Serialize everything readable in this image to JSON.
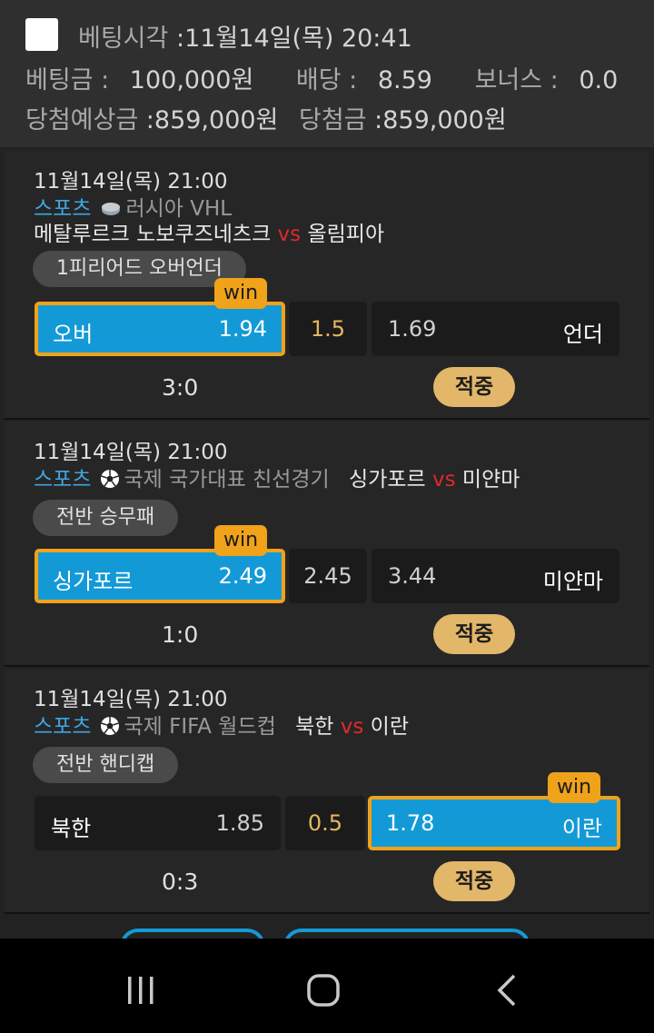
{
  "header": {
    "bet_time_label": "베팅시각",
    "bet_time_value": ":11월14일(목) 20:41",
    "amount_label": "베팅금 :",
    "amount_value": "100,000원",
    "odds_label": "배당 :",
    "odds_value": "8.59",
    "bonus_label": "보너스 :",
    "bonus_value": "0.0",
    "expected_label": "당첨예상금",
    "expected_value": ":859,000원",
    "won_label": "당첨금",
    "won_value": ":859,000원"
  },
  "bets": [
    {
      "time": "11월14일(목) 21:00",
      "category": "스포츠",
      "icon": "hockey-puck-icon",
      "league": "러시아 VHL",
      "home": "메탈루르크 노보쿠즈네츠크",
      "vs": "vs",
      "away": "올림피아",
      "market": "1피리어드 오버언더",
      "left_name": "오버",
      "left_odds": "1.94",
      "middle": "1.5",
      "right_odds": "1.69",
      "right_name": "언더",
      "win_label": "win",
      "score": "3:0",
      "result": "적중"
    },
    {
      "time": "11월14일(목) 21:00",
      "category": "스포츠",
      "icon": "soccer-ball-icon",
      "league": "국제 국가대표 친선경기",
      "home": "싱가포르",
      "vs": "vs",
      "away": "미얀마",
      "market": "전반 승무패",
      "left_name": "싱가포르",
      "left_odds": "2.49",
      "middle": "2.45",
      "right_odds": "3.44",
      "right_name": "미얀마",
      "win_label": "win",
      "score": "1:0",
      "result": "적중"
    },
    {
      "time": "11월14일(목) 21:00",
      "category": "스포츠",
      "icon": "soccer-ball-icon",
      "league": "국제 FIFA 월드컵",
      "home": "북한",
      "vs": "vs",
      "away": "이란",
      "market": "전반 핸디캡",
      "left_name": "북한",
      "left_odds": "1.85",
      "middle": "0.5",
      "right_odds": "1.78",
      "right_name": "이란",
      "win_label": "win",
      "score": "0:3",
      "result": "적중"
    }
  ],
  "navbar": {
    "recents_icon": "recents-icon",
    "home_icon": "home-icon",
    "back_icon": "back-icon"
  }
}
